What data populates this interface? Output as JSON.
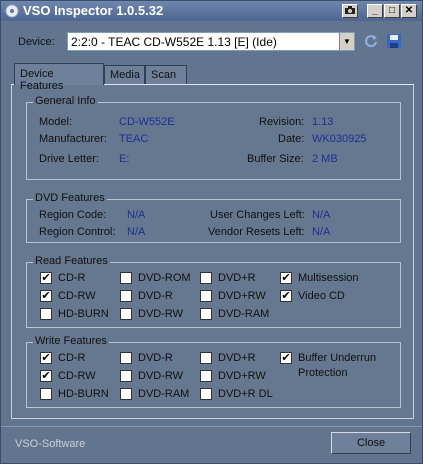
{
  "window": {
    "title": "VSO Inspector 1.0.5.32",
    "min_glyph": "_",
    "max_glyph": "□",
    "close_glyph": "✕"
  },
  "device": {
    "label": "Device:",
    "value": "2:2:0 - TEAC CD-W552E 1.13 [E] (Ide)",
    "arrow": "▼"
  },
  "tabs": [
    {
      "label": "Device Features",
      "active": true
    },
    {
      "label": "Media",
      "active": false
    },
    {
      "label": "Scan",
      "active": false
    }
  ],
  "general": {
    "title": "General Info",
    "model_label": "Model:",
    "model": "CD-W552E",
    "manufacturer_label": "Manufacturer:",
    "manufacturer": "TEAC",
    "drive_label": "Drive Letter:",
    "drive": "E:",
    "revision_label": "Revision:",
    "revision": "1.13",
    "date_label": "Date:",
    "date": "WK030925",
    "buffer_label": "Buffer Size:",
    "buffer": "2 MB"
  },
  "dvd": {
    "title": "DVD Features",
    "region_code_label": "Region Code:",
    "region_code": "N/A",
    "region_control_label": "Region Control:",
    "region_control": "N/A",
    "user_changes_label": "User Changes Left:",
    "user_changes": "N/A",
    "vendor_resets_label": "Vendor Resets Left:",
    "vendor_resets": "N/A"
  },
  "read": {
    "title": "Read Features",
    "items": [
      {
        "label": "CD-R",
        "checked": true
      },
      {
        "label": "DVD-ROM",
        "checked": false
      },
      {
        "label": "DVD+R",
        "checked": false
      },
      {
        "label": "Multisession",
        "checked": true
      },
      {
        "label": "CD-RW",
        "checked": true
      },
      {
        "label": "DVD-R",
        "checked": false
      },
      {
        "label": "DVD+RW",
        "checked": false
      },
      {
        "label": "Video CD",
        "checked": true
      },
      {
        "label": "HD-BURN",
        "checked": false
      },
      {
        "label": "DVD-RW",
        "checked": false
      },
      {
        "label": "DVD-RAM",
        "checked": false
      }
    ]
  },
  "write": {
    "title": "Write Features",
    "items": [
      {
        "label": "CD-R",
        "checked": true
      },
      {
        "label": "DVD-R",
        "checked": false
      },
      {
        "label": "DVD+R",
        "checked": false
      },
      {
        "label": "Buffer Underrun",
        "checked": true
      },
      {
        "label": "CD-RW",
        "checked": true
      },
      {
        "label": "DVD-RW",
        "checked": false
      },
      {
        "label": "DVD+RW",
        "checked": false
      },
      {
        "label": "HD-BURN",
        "checked": false
      },
      {
        "label": "DVD-RAM",
        "checked": false
      },
      {
        "label": "DVD+R DL",
        "checked": false
      }
    ],
    "buffer_underrun_line2": "Protection"
  },
  "check_glyph": "✔",
  "footer": {
    "status": "VSO-Software",
    "close_label": "Close"
  },
  "colors": {
    "window_bg": "#65788f",
    "titlebar": "#4d6690",
    "value_text": "#1c2f93"
  }
}
